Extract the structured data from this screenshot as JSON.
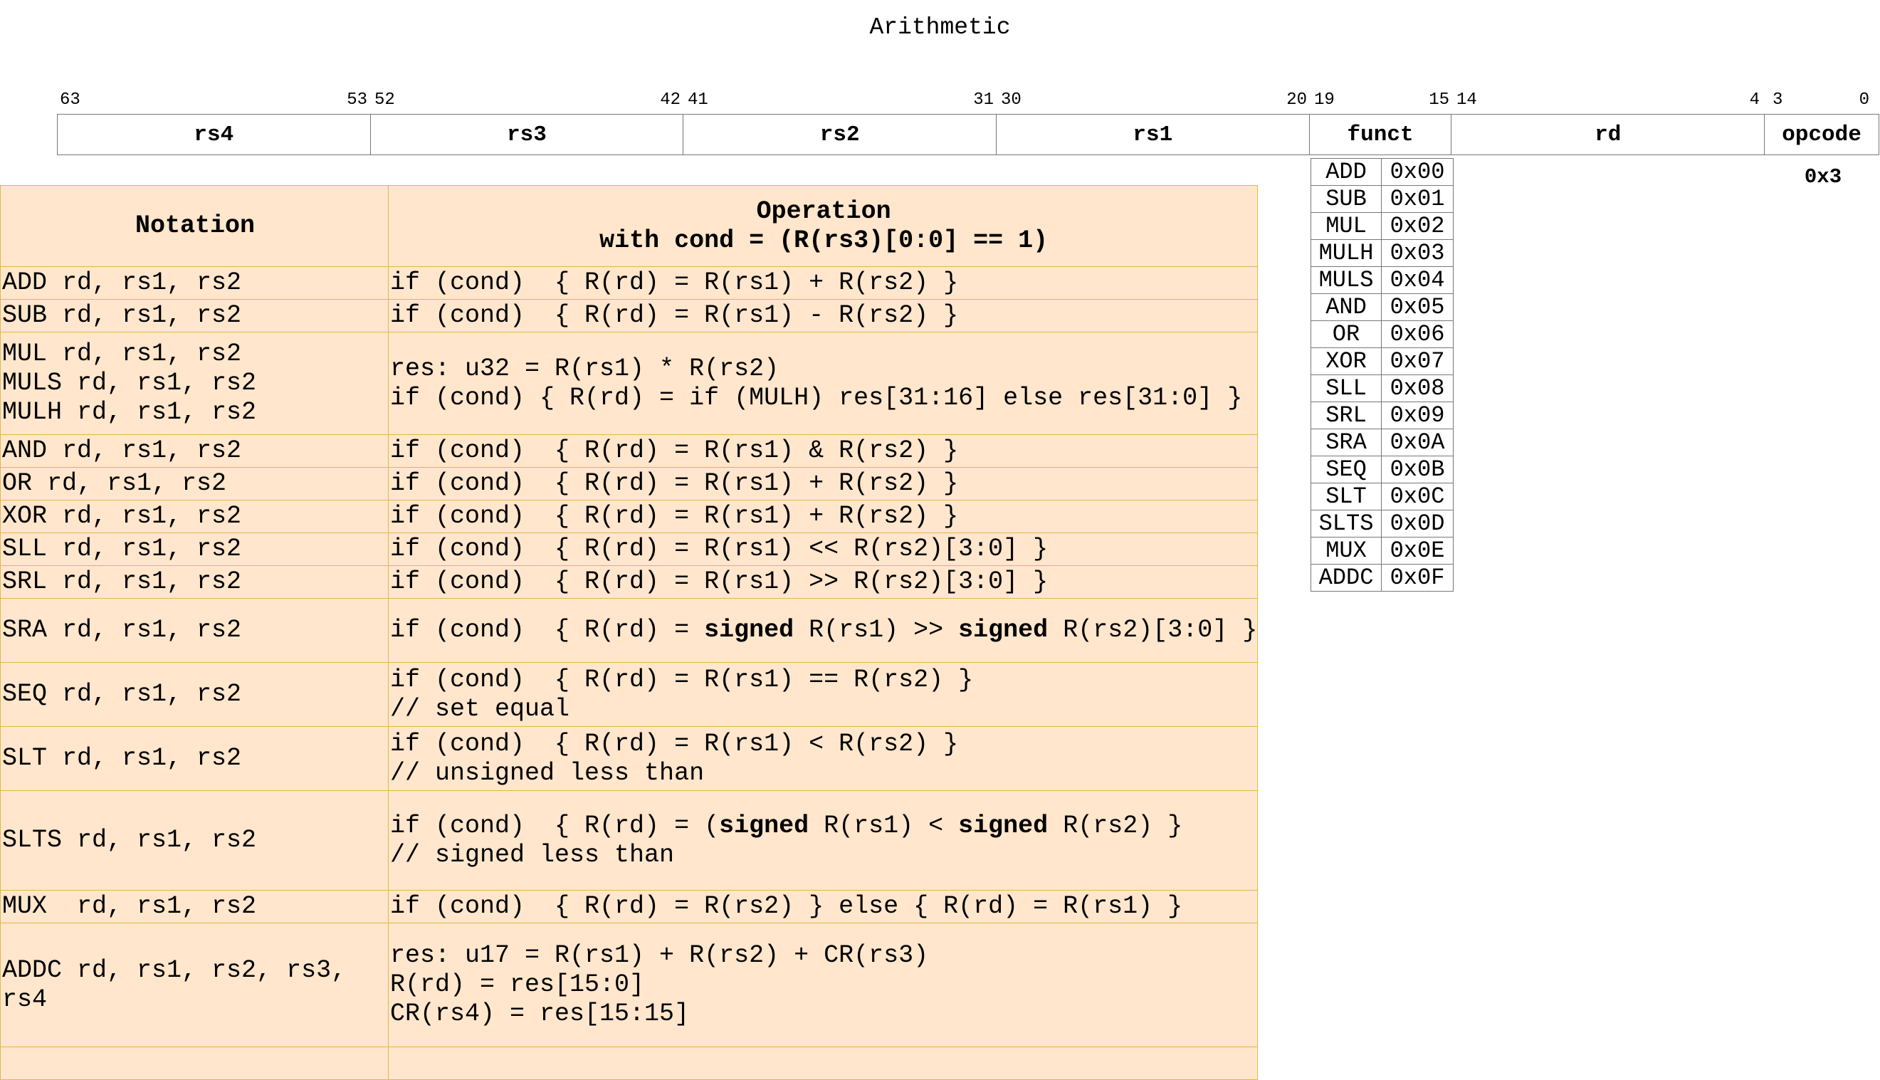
{
  "title": "Arithmetic",
  "bit_numbers": [
    "63",
    "53",
    "52",
    "42",
    "41",
    "31",
    "30",
    "20",
    "19",
    "15",
    "14",
    "4",
    "3",
    "0"
  ],
  "fields": [
    {
      "name": "rs4"
    },
    {
      "name": "rs3"
    },
    {
      "name": "rs2"
    },
    {
      "name": "rs1"
    },
    {
      "name": "funct"
    },
    {
      "name": "rd"
    },
    {
      "name": "opcode"
    }
  ],
  "opcode_value": "0x3",
  "funct_codes": [
    {
      "name": "ADD",
      "code": "0x00"
    },
    {
      "name": "SUB",
      "code": "0x01"
    },
    {
      "name": "MUL",
      "code": "0x02"
    },
    {
      "name": "MULH",
      "code": "0x03"
    },
    {
      "name": "MULS",
      "code": "0x04"
    },
    {
      "name": "AND",
      "code": "0x05"
    },
    {
      "name": "OR",
      "code": "0x06"
    },
    {
      "name": "XOR",
      "code": "0x07"
    },
    {
      "name": "SLL",
      "code": "0x08"
    },
    {
      "name": "SRL",
      "code": "0x09"
    },
    {
      "name": "SRA",
      "code": "0x0A"
    },
    {
      "name": "SEQ",
      "code": "0x0B"
    },
    {
      "name": "SLT",
      "code": "0x0C"
    },
    {
      "name": "SLTS",
      "code": "0x0D"
    },
    {
      "name": "MUX",
      "code": "0x0E"
    },
    {
      "name": "ADDC",
      "code": "0x0F"
    }
  ],
  "table": {
    "header_notation": "Notation",
    "header_operation_1": "Operation",
    "header_operation_2": "with cond = (R(rs3)[0:0] == 1)",
    "rows": [
      {
        "notation": [
          "ADD rd, rs1, rs2"
        ],
        "operation": [
          [
            {
              "t": "if (cond)  { R(rd) = R(rs1) + R(rs2) }"
            }
          ]
        ]
      },
      {
        "notation": [
          "SUB rd, rs1, rs2"
        ],
        "operation": [
          [
            {
              "t": "if (cond)  { R(rd) = R(rs1) - R(rs2) }"
            }
          ]
        ]
      },
      {
        "notation": [
          "MUL rd, rs1, rs2",
          "MULS rd, rs1, rs2",
          "MULH rd, rs1, rs2"
        ],
        "operation": [
          [
            {
              "t": "res: u32 = R(rs1) * R(rs2)"
            }
          ],
          [
            {
              "t": "if (cond) { R(rd) = if (MULH) res[31:16] else res[31:0] }"
            }
          ]
        ]
      },
      {
        "notation": [
          "AND rd, rs1, rs2"
        ],
        "operation": [
          [
            {
              "t": "if (cond)  { R(rd) = R(rs1) & R(rs2) }"
            }
          ]
        ]
      },
      {
        "notation": [
          "OR rd, rs1, rs2"
        ],
        "operation": [
          [
            {
              "t": "if (cond)  { R(rd) = R(rs1) + R(rs2) }"
            }
          ]
        ]
      },
      {
        "notation": [
          "XOR rd, rs1, rs2"
        ],
        "operation": [
          [
            {
              "t": "if (cond)  { R(rd) = R(rs1) + R(rs2) }"
            }
          ]
        ]
      },
      {
        "notation": [
          "SLL rd, rs1, rs2"
        ],
        "operation": [
          [
            {
              "t": "if (cond)  { R(rd) = R(rs1) << R(rs2)[3:0] }"
            }
          ]
        ]
      },
      {
        "notation": [
          "SRL rd, rs1, rs2"
        ],
        "operation": [
          [
            {
              "t": "if (cond)  { R(rd) = R(rs1) >> R(rs2)[3:0] }"
            }
          ]
        ]
      },
      {
        "notation": [
          "SRA rd, rs1, rs2"
        ],
        "operation": [
          [
            {
              "t": "if (cond)  { R(rd) = "
            },
            {
              "t": "signed",
              "b": true
            },
            {
              "t": " R(rs1) >> "
            },
            {
              "t": "signed",
              "b": true
            },
            {
              "t": " R(rs2)[3:0] }"
            }
          ]
        ]
      },
      {
        "notation": [
          "SEQ rd, rs1, rs2"
        ],
        "operation": [
          [
            {
              "t": "if (cond)  { R(rd) = R(rs1) == R(rs2) }"
            }
          ],
          [
            {
              "t": "// set equal"
            }
          ]
        ]
      },
      {
        "notation": [
          "SLT rd, rs1, rs2"
        ],
        "operation": [
          [
            {
              "t": "if (cond)  { R(rd) = R(rs1) < R(rs2) }"
            }
          ],
          [
            {
              "t": "// unsigned less than"
            }
          ]
        ]
      },
      {
        "notation": [
          "SLTS rd, rs1, rs2"
        ],
        "operation": [
          [
            {
              "t": "if (cond)  { R(rd) = ("
            },
            {
              "t": "signed",
              "b": true
            },
            {
              "t": " R(rs1) < "
            },
            {
              "t": "signed",
              "b": true
            },
            {
              "t": " R(rs2) }"
            }
          ],
          [
            {
              "t": "// signed less than"
            }
          ]
        ]
      },
      {
        "notation": [
          "MUX  rd, rs1, rs2"
        ],
        "operation": [
          [
            {
              "t": "if (cond)  { R(rd) = R(rs2) } else { R(rd) = R(rs1) }"
            }
          ]
        ]
      },
      {
        "notation": [
          "ADDC rd, rs1, rs2, rs3,",
          "rs4"
        ],
        "operation": [
          [
            {
              "t": "res: u17 = R(rs1) + R(rs2) + CR(rs3)"
            }
          ],
          [
            {
              "t": "R(rd) = res[15:0]"
            }
          ],
          [
            {
              "t": "CR(rs4) = res[15:15]"
            }
          ]
        ]
      },
      {
        "notation": [],
        "operation": []
      }
    ]
  }
}
